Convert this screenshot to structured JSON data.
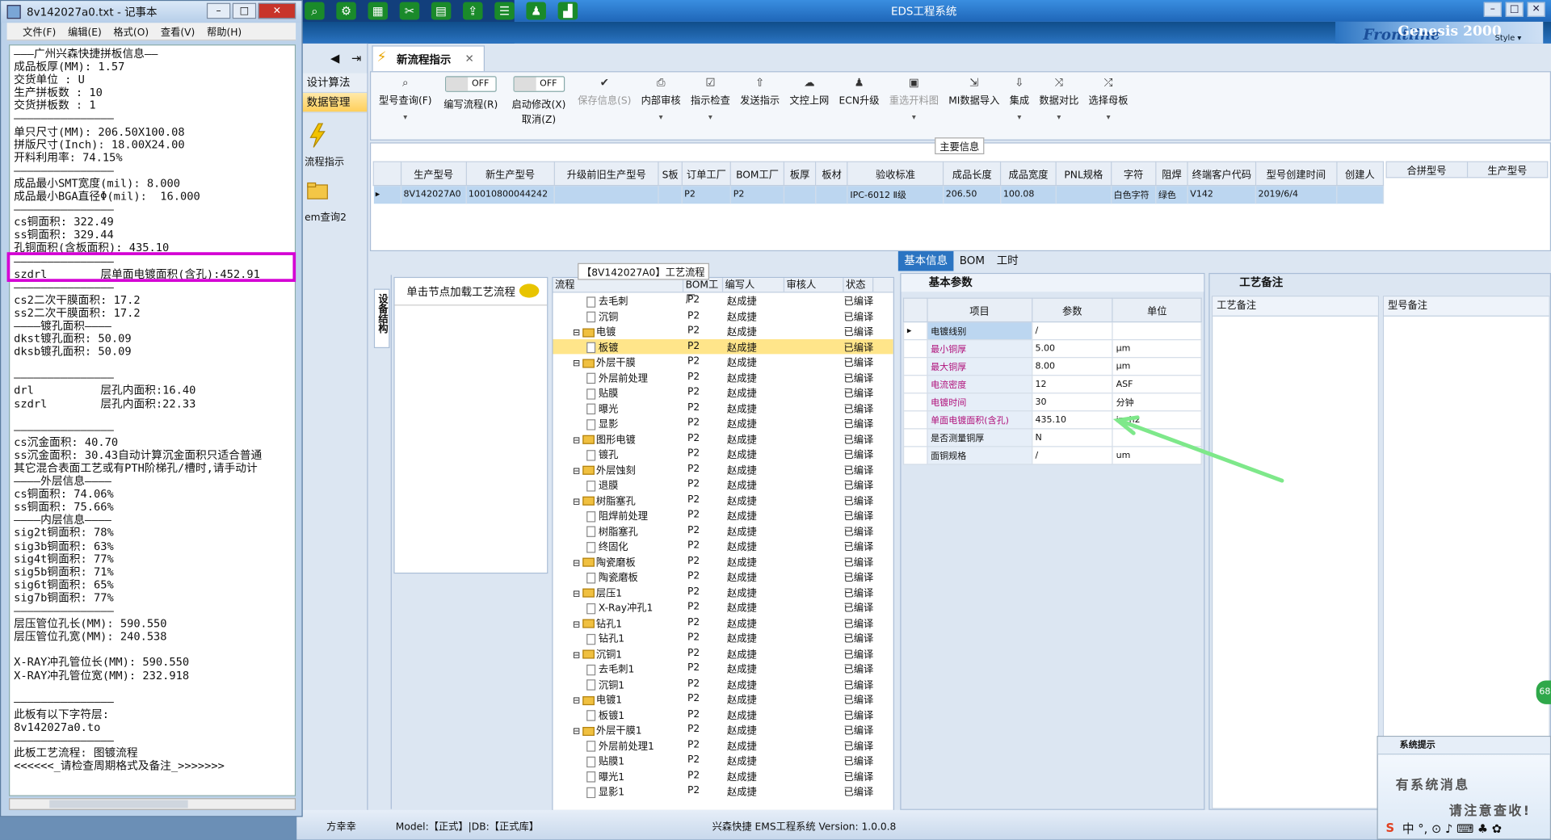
{
  "eds": {
    "title": "EDS工程系统",
    "logo_text": "Frontline",
    "logo_text2": "Genesis 2000",
    "style_label": "Style ▾",
    "top_icons": [
      "search-icon",
      "gear-icon",
      "grid-icon",
      "scissors-icon",
      "film-icon",
      "export-icon",
      "list-icon",
      "user-icon",
      "chart-icon"
    ],
    "nav": {
      "items": [
        {
          "label": "设计算法",
          "active": false
        },
        {
          "label": "数据管理",
          "active": true
        }
      ],
      "icon_labels": [
        "流程指示",
        "em查询2"
      ]
    },
    "tab_main": "新流程指示",
    "toolbar": {
      "buttons": [
        {
          "label": "型号查询(F)",
          "icon": "search-icon",
          "disabled": false
        },
        {
          "label": "编写流程(R)",
          "icon": "toggle-off",
          "toggle": "OFF",
          "disabled": false
        },
        {
          "label": "启动修改(X)\n取消(Z)",
          "icon": "toggle-off",
          "toggle": "OFF",
          "disabled": false
        },
        {
          "label": "保存信息(S)",
          "icon": "check-icon",
          "disabled": true
        },
        {
          "label": "内部审核",
          "icon": "printer-icon",
          "disabled": false
        },
        {
          "label": "指示检查",
          "icon": "checkbox-icon",
          "disabled": false
        },
        {
          "label": "发送指示",
          "icon": "upload-icon",
          "disabled": false
        },
        {
          "label": "文控上网",
          "icon": "cloud-icon",
          "disabled": false
        },
        {
          "label": "ECN升级",
          "icon": "people-icon",
          "disabled": false
        },
        {
          "label": "重选开料图",
          "icon": "image-icon",
          "disabled": true
        },
        {
          "label": "MI数据导入",
          "icon": "import-icon",
          "disabled": false
        },
        {
          "label": "集成",
          "icon": "download-icon",
          "disabled": false
        },
        {
          "label": "数据对比",
          "icon": "compare-icon",
          "disabled": false
        },
        {
          "label": "选择母板",
          "icon": "shuffle-icon",
          "disabled": false
        }
      ]
    },
    "main_info_label": "主要信息",
    "grid1": {
      "headers": [
        "生产型号",
        "新生产型号",
        "升级前旧生产型号",
        "S板",
        "订单工厂",
        "BOM工厂",
        "板厚",
        "板材",
        "验收标准",
        "成品长度",
        "成品宽度",
        "PNL规格",
        "字符",
        "阻焊",
        "终端客户代码",
        "型号创建时间",
        "创建人"
      ],
      "row": [
        "8V142027A0",
        "10010800044242",
        "",
        "",
        "P2",
        "P2",
        "",
        "",
        "IPC-6012 Ⅱ级",
        "206.50",
        "100.08",
        "",
        "白色字符",
        "绿色",
        "V142",
        "2019/6/4",
        ""
      ]
    },
    "grid2": {
      "headers": [
        "合拼型号",
        "生产型号"
      ]
    },
    "flow_title": "【8V142027A0】工艺流程",
    "side_vtab": "设备结构",
    "click_hint": "单击节点加载工艺流程",
    "tree_headers": [
      "流程",
      "BOM工厂",
      "编写人",
      "审核人",
      "状态"
    ],
    "tree_rows": [
      {
        "indent": 2,
        "folder": false,
        "name": "去毛刺",
        "bom": "P2",
        "writer": "赵成捷",
        "status": "已编译"
      },
      {
        "indent": 2,
        "folder": false,
        "name": "沉铜",
        "bom": "P2",
        "writer": "赵成捷",
        "status": "已编译"
      },
      {
        "indent": 1,
        "folder": true,
        "name": "电镀",
        "bom": "P2",
        "writer": "赵成捷",
        "status": "已编译"
      },
      {
        "indent": 2,
        "folder": false,
        "name": "板镀",
        "bom": "P2",
        "writer": "赵成捷",
        "status": "已编译",
        "selected": true
      },
      {
        "indent": 1,
        "folder": true,
        "name": "外层干膜",
        "bom": "P2",
        "writer": "赵成捷",
        "status": "已编译"
      },
      {
        "indent": 2,
        "folder": false,
        "name": "外层前处理",
        "bom": "P2",
        "writer": "赵成捷",
        "status": "已编译"
      },
      {
        "indent": 2,
        "folder": false,
        "name": "贴膜",
        "bom": "P2",
        "writer": "赵成捷",
        "status": "已编译"
      },
      {
        "indent": 2,
        "folder": false,
        "name": "曝光",
        "bom": "P2",
        "writer": "赵成捷",
        "status": "已编译"
      },
      {
        "indent": 2,
        "folder": false,
        "name": "显影",
        "bom": "P2",
        "writer": "赵成捷",
        "status": "已编译"
      },
      {
        "indent": 1,
        "folder": true,
        "name": "图形电镀",
        "bom": "P2",
        "writer": "赵成捷",
        "status": "已编译"
      },
      {
        "indent": 2,
        "folder": false,
        "name": "镀孔",
        "bom": "P2",
        "writer": "赵成捷",
        "status": "已编译"
      },
      {
        "indent": 1,
        "folder": true,
        "name": "外层蚀刻",
        "bom": "P2",
        "writer": "赵成捷",
        "status": "已编译"
      },
      {
        "indent": 2,
        "folder": false,
        "name": "退膜",
        "bom": "P2",
        "writer": "赵成捷",
        "status": "已编译"
      },
      {
        "indent": 1,
        "folder": true,
        "name": "树脂塞孔",
        "bom": "P2",
        "writer": "赵成捷",
        "status": "已编译"
      },
      {
        "indent": 2,
        "folder": false,
        "name": "阻焊前处理",
        "bom": "P2",
        "writer": "赵成捷",
        "status": "已编译"
      },
      {
        "indent": 2,
        "folder": false,
        "name": "树脂塞孔",
        "bom": "P2",
        "writer": "赵成捷",
        "status": "已编译"
      },
      {
        "indent": 2,
        "folder": false,
        "name": "终固化",
        "bom": "P2",
        "writer": "赵成捷",
        "status": "已编译"
      },
      {
        "indent": 1,
        "folder": true,
        "name": "陶瓷磨板",
        "bom": "P2",
        "writer": "赵成捷",
        "status": "已编译"
      },
      {
        "indent": 2,
        "folder": false,
        "name": "陶瓷磨板",
        "bom": "P2",
        "writer": "赵成捷",
        "status": "已编译"
      },
      {
        "indent": 1,
        "folder": true,
        "name": "层压1",
        "bom": "P2",
        "writer": "赵成捷",
        "status": "已编译"
      },
      {
        "indent": 2,
        "folder": false,
        "name": "X-Ray冲孔1",
        "bom": "P2",
        "writer": "赵成捷",
        "status": "已编译"
      },
      {
        "indent": 1,
        "folder": true,
        "name": "钻孔1",
        "bom": "P2",
        "writer": "赵成捷",
        "status": "已编译"
      },
      {
        "indent": 2,
        "folder": false,
        "name": "钻孔1",
        "bom": "P2",
        "writer": "赵成捷",
        "status": "已编译"
      },
      {
        "indent": 1,
        "folder": true,
        "name": "沉铜1",
        "bom": "P2",
        "writer": "赵成捷",
        "status": "已编译"
      },
      {
        "indent": 2,
        "folder": false,
        "name": "去毛刺1",
        "bom": "P2",
        "writer": "赵成捷",
        "status": "已编译"
      },
      {
        "indent": 2,
        "folder": false,
        "name": "沉铜1",
        "bom": "P2",
        "writer": "赵成捷",
        "status": "已编译"
      },
      {
        "indent": 1,
        "folder": true,
        "name": "电镀1",
        "bom": "P2",
        "writer": "赵成捷",
        "status": "已编译"
      },
      {
        "indent": 2,
        "folder": false,
        "name": "板镀1",
        "bom": "P2",
        "writer": "赵成捷",
        "status": "已编译"
      },
      {
        "indent": 1,
        "folder": true,
        "name": "外层干膜1",
        "bom": "P2",
        "writer": "赵成捷",
        "status": "已编译"
      },
      {
        "indent": 2,
        "folder": false,
        "name": "外层前处理1",
        "bom": "P2",
        "writer": "赵成捷",
        "status": "已编译"
      },
      {
        "indent": 2,
        "folder": false,
        "name": "贴膜1",
        "bom": "P2",
        "writer": "赵成捷",
        "status": "已编译"
      },
      {
        "indent": 2,
        "folder": false,
        "name": "曝光1",
        "bom": "P2",
        "writer": "赵成捷",
        "status": "已编译"
      },
      {
        "indent": 2,
        "folder": false,
        "name": "显影1",
        "bom": "P2",
        "writer": "赵成捷",
        "status": "已编译"
      }
    ],
    "right_tabs": [
      "基本信息",
      "BOM",
      "工时"
    ],
    "params_title": "基本参数",
    "params_headers": [
      "项目",
      "参数",
      "单位"
    ],
    "params_rows": [
      {
        "item": "电镀线别",
        "value": "/",
        "unit": "",
        "color": "black",
        "selected": true
      },
      {
        "item": "最小铜厚",
        "value": "5.00",
        "unit": "μm",
        "color": "magenta"
      },
      {
        "item": "最大铜厚",
        "value": "8.00",
        "unit": "μm",
        "color": "magenta"
      },
      {
        "item": "电流密度",
        "value": "12",
        "unit": "ASF",
        "color": "magenta"
      },
      {
        "item": "电镀时间",
        "value": "30",
        "unit": "分钟",
        "color": "magenta"
      },
      {
        "item": "单面电镀面积(含孔)",
        "value": "435.10",
        "unit": "inch2",
        "color": "magenta"
      },
      {
        "item": "是否测量铜厚",
        "value": "N",
        "unit": "",
        "color": "black"
      },
      {
        "item": "面铜规格",
        "value": "/",
        "unit": "um",
        "color": "black"
      }
    ],
    "notes_title": "工艺备注",
    "notes_cols": [
      "工艺备注",
      "型号备注"
    ],
    "statusbar": {
      "user": "方幸幸",
      "model": "Model:【正式】|DB:【正式库】",
      "version": "兴森快捷 EMS工程系统 Version: 1.0.0.8"
    },
    "sysmsg": {
      "title": "系统提示",
      "line1": "有系统消息",
      "line2": "请注意查收!",
      "tray": "中 °, ⊙ ♪ ⌨ ♣ ✿"
    },
    "badge": "68",
    "colors": {
      "accent": "#2b74c2",
      "highlight": "#ffe58a",
      "magenta_label": "#b0107a",
      "arrow": "#7ee88a"
    }
  },
  "notepad": {
    "title": "8v142027a0.txt - 记事本",
    "menu": [
      "文件(F)",
      "编辑(E)",
      "格式(O)",
      "查看(V)",
      "帮助(H)"
    ],
    "lines": [
      "———广州兴森快捷拼板信息——",
      "成品板厚(MM): 1.57",
      "交货单位 : U",
      "生产拼板数 : 10",
      "交货拼板数 : 1",
      "———————————————",
      "单只尺寸(MM): 206.50X100.08",
      "拼版尺寸(Inch): 18.00X24.00",
      "开料利用率: 74.15%",
      "———————————————",
      "成品最小SMT宽度(mil): 8.000",
      "成品最小BGA直径Φ(mil):  16.000",
      "———————————————",
      "cs铜面积: 322.49",
      "ss铜面积: 329.44",
      "孔铜面积(含板面积): 435.10",
      "———————————————",
      "szdrl        层单面电镀面积(含孔):452.91",
      "———————————————",
      "cs2二次干膜面积: 17.2",
      "ss2二次干膜面积: 17.2",
      "————镀孔面积————",
      "dkst镀孔面积: 50.09",
      "dksb镀孔面积: 50.09",
      "",
      "———————————————",
      "drl          层孔内面积:16.40",
      "szdrl        层孔内面积:22.33",
      "",
      "———————————————",
      "cs沉金面积: 40.70",
      "ss沉金面积: 30.43自动计算沉金面积只适合普通",
      "其它混合表面工艺或有PTH阶梯孔/槽时,请手动计",
      "————外层信息————",
      "cs铜面积: 74.06%",
      "ss铜面积: 75.66%",
      "————内层信息————",
      "sig2t铜面积: 78%",
      "sig3b铜面积: 63%",
      "sig4t铜面积: 77%",
      "sig5b铜面积: 71%",
      "sig6t铜面积: 65%",
      "sig7b铜面积: 77%",
      "———————————————",
      "层压管位孔长(MM): 590.550",
      "层压管位孔宽(MM): 240.538",
      "",
      "X-RAY冲孔管位长(MM): 590.550",
      "X-RAY冲孔管位宽(MM): 232.918",
      "",
      "———————————————",
      "此板有以下字符层:",
      "8v142027a0.to",
      "———————————————",
      "此板工艺流程: 图镀流程",
      "<<<<<<_请检查周期格式及备注_>>>>>>>"
    ]
  }
}
